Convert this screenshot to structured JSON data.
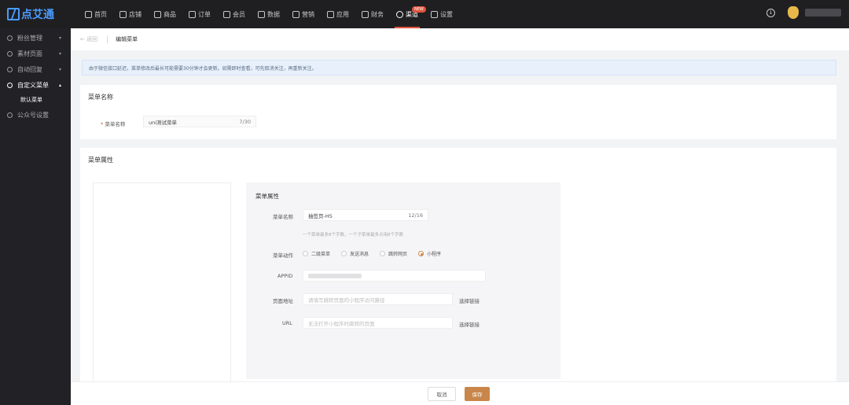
{
  "brand": {
    "name": "点艾通"
  },
  "nav": [
    {
      "label": "首页",
      "icon": "home-icon"
    },
    {
      "label": "店铺",
      "icon": "store-icon"
    },
    {
      "label": "商品",
      "icon": "goods-icon"
    },
    {
      "label": "订单",
      "icon": "order-icon"
    },
    {
      "label": "会员",
      "icon": "member-icon"
    },
    {
      "label": "数据",
      "icon": "data-icon"
    },
    {
      "label": "营销",
      "icon": "marketing-icon"
    },
    {
      "label": "应用",
      "icon": "app-icon"
    },
    {
      "label": "财务",
      "icon": "finance-icon"
    },
    {
      "label": "渠道",
      "icon": "channel-icon",
      "badge": "NEW"
    },
    {
      "label": "设置",
      "icon": "settings-icon"
    }
  ],
  "sidebar": {
    "items": [
      {
        "label": "粉丝管理",
        "caret": "▾"
      },
      {
        "label": "素材页面",
        "caret": "▾"
      },
      {
        "label": "自动回复",
        "caret": "▾"
      },
      {
        "label": "自定义菜单",
        "caret": "▴"
      },
      {
        "label": "公众号设置",
        "caret": ""
      }
    ],
    "sub": "默认菜单"
  },
  "breadcrumb": {
    "back": "← 返回",
    "current": "编辑菜单"
  },
  "notice": "由于微信接口延迟，菜单修改后最长可能需要30分钟才会更新。如需即时查看，可先取消关注，再重新关注。",
  "menu_name": {
    "section": "菜单名称",
    "label": "菜单名称",
    "value": "uni测试菜单",
    "counter": "7/30"
  },
  "menu_attr": {
    "section": "菜单属性",
    "panel_title": "菜单属性",
    "name_label": "菜单名称",
    "name_value": "抽签页-H5",
    "name_counter": "12/16",
    "hint": "一个菜单最多8个字数，一个子菜单最多占用8个字数",
    "action_label": "菜单动作",
    "actions": [
      "二级菜单",
      "发送消息",
      "跳转网页",
      "小程序"
    ],
    "appid_label": "APPID",
    "page_label": "页面地址",
    "page_placeholder": "请填写跳转页面的小程序访问路径",
    "page_link": "选择链接",
    "url_label": "URL",
    "url_placeholder": "无法打开小程序时跳转的页面",
    "url_link": "选择链接"
  },
  "footer": {
    "cancel": "取消",
    "save": "保存"
  },
  "colors": {
    "accent": "#c8864a",
    "nav_bg": "#1f1f22",
    "sidebar_bg": "#222226",
    "alert": "#e0533b"
  }
}
